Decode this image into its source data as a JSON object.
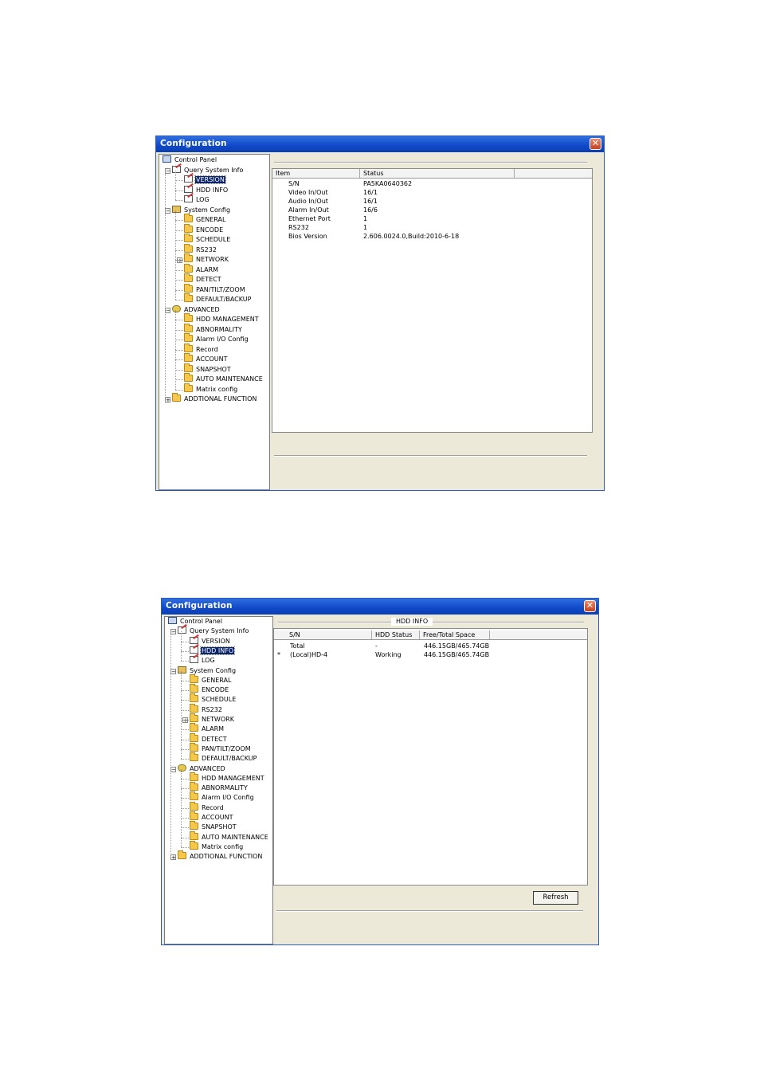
{
  "window1": {
    "title": "Configuration",
    "close": "✕",
    "tree": {
      "root": "Control Panel",
      "query": "Query System Info",
      "query_items": [
        "VERSION",
        "HDD INFO",
        "LOG"
      ],
      "system": "System Config",
      "system_items": [
        "GENERAL",
        "ENCODE",
        "SCHEDULE",
        "RS232",
        "NETWORK",
        "ALARM",
        "DETECT",
        "PAN/TILT/ZOOM",
        "DEFAULT/BACKUP"
      ],
      "advanced": "ADVANCED",
      "advanced_items": [
        "HDD MANAGEMENT",
        "ABNORMALITY",
        "Alarm I/O Config",
        "Record",
        "ACCOUNT",
        "SNAPSHOT",
        "AUTO MAINTENANCE",
        "Matrix config"
      ],
      "additional": "ADDTIONAL FUNCTION",
      "selected": "VERSION"
    },
    "table": {
      "columns": [
        "Item",
        "Status"
      ],
      "rows": [
        [
          "S/N",
          "PA5KA0640362"
        ],
        [
          "Video In/Out",
          "16/1"
        ],
        [
          "Audio In/Out",
          "16/1"
        ],
        [
          "Alarm In/Out",
          "16/6"
        ],
        [
          "Ethernet Port",
          "1"
        ],
        [
          "RS232",
          "1"
        ],
        [
          "Bios Version",
          "2.606.0024.0,Build:2010-6-18"
        ]
      ]
    }
  },
  "window2": {
    "title": "Configuration",
    "close": "✕",
    "section_caption": "HDD INFO",
    "selected": "HDD INFO",
    "table": {
      "columns": [
        "S/N",
        "HDD Status",
        "Free/Total Space"
      ],
      "rows": [
        {
          "marker": "",
          "sn": "Total",
          "status": "-",
          "space": "446.15GB/465.74GB"
        },
        {
          "marker": "*",
          "sn": "(Local)HD-4",
          "status": "Working",
          "space": "446.15GB/465.74GB"
        }
      ]
    },
    "refresh_label": "Refresh"
  }
}
